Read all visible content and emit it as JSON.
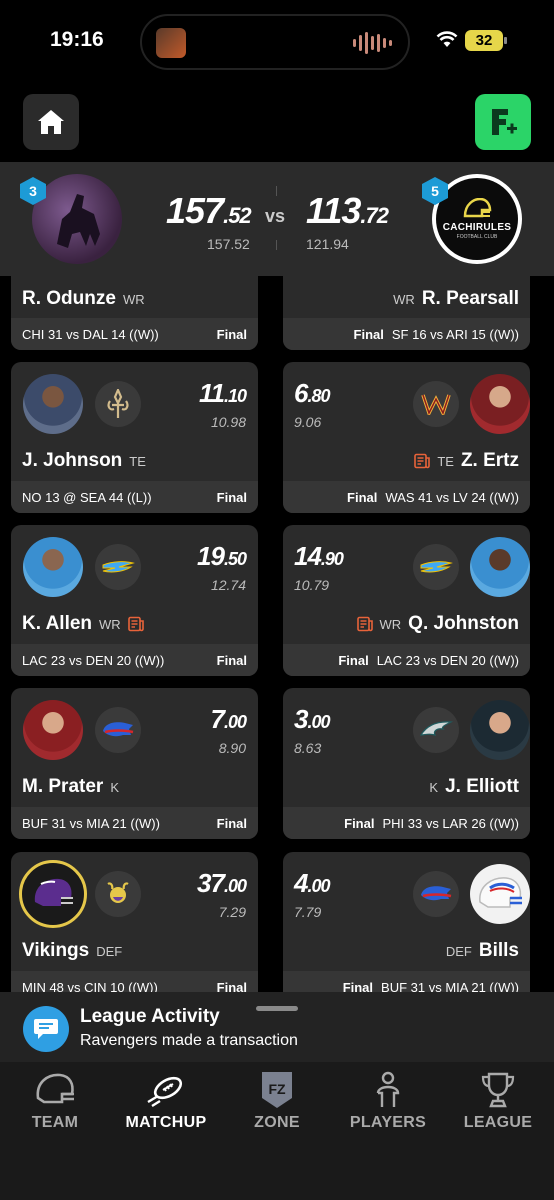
{
  "status": {
    "time": "19:16",
    "battery": "32"
  },
  "matchup": {
    "left": {
      "rank": "3",
      "score_int": "157",
      "score_dec": ".52",
      "projected": "157.52"
    },
    "right": {
      "rank": "5",
      "score_int": "113",
      "score_dec": ".72",
      "projected": "121.94",
      "logo_text": "CACHIRULES",
      "logo_sub": "FOOTBALL CLUB"
    },
    "vs": "vs"
  },
  "rows": [
    {
      "left": {
        "name": "R. Odunze",
        "pos": "WR",
        "game": "CHI 31 vs DAL 14 ((W))",
        "status": "Final"
      },
      "right": {
        "name": "R. Pearsall",
        "pos": "WR",
        "game": "SF 16 vs ARI 15 ((W))",
        "status": "Final"
      }
    },
    {
      "left": {
        "name": "J. Johnson",
        "pos": "TE",
        "pts_int": "11",
        "pts_dec": ".10",
        "proj": "10.98",
        "game": "NO 13 @ SEA 44 ((L))",
        "status": "Final",
        "team": "NO",
        "team_color": "#d3bc8d"
      },
      "right": {
        "name": "Z. Ertz",
        "pos": "TE",
        "pts_int": "6",
        "pts_dec": ".80",
        "proj": "9.06",
        "game": "WAS 41 vs LV 24 ((W))",
        "status": "Final",
        "team": "W",
        "team_color": "#c33a1a"
      }
    },
    {
      "left": {
        "name": "K. Allen",
        "pos": "WR",
        "pts_int": "19",
        "pts_dec": ".50",
        "proj": "12.74",
        "game": "LAC 23 vs DEN 20 ((W))",
        "status": "Final",
        "team": "LAC",
        "team_color": "#3fa9f5"
      },
      "right": {
        "name": "Q. Johnston",
        "pos": "WR",
        "pts_int": "14",
        "pts_dec": ".90",
        "proj": "10.79",
        "game": "LAC 23 vs DEN 20 ((W))",
        "status": "Final",
        "team": "LAC",
        "team_color": "#3fa9f5"
      }
    },
    {
      "left": {
        "name": "M. Prater",
        "pos": "K",
        "pts_int": "7",
        "pts_dec": ".00",
        "proj": "8.90",
        "game": "BUF 31 vs MIA 21 ((W))",
        "status": "Final",
        "team": "BUF",
        "team_color": "#2a5fd6"
      },
      "right": {
        "name": "J. Elliott",
        "pos": "K",
        "pts_int": "3",
        "pts_dec": ".00",
        "proj": "8.63",
        "game": "PHI 33 vs LAR 26 ((W))",
        "status": "Final",
        "team": "PHI",
        "team_color": "#1f5b5e"
      }
    },
    {
      "left": {
        "name": "Vikings",
        "pos": "DEF",
        "pts_int": "37",
        "pts_dec": ".00",
        "proj": "7.29",
        "game": "MIN 48 vs CIN 10 ((W))",
        "status": "Final",
        "team": "MIN",
        "team_color": "#6a3fa0"
      },
      "right": {
        "name": "Bills",
        "pos": "DEF",
        "pts_int": "4",
        "pts_dec": ".00",
        "proj": "7.79",
        "game": "BUF 31 vs MIA 21 ((W))",
        "status": "Final",
        "team": "BUF",
        "team_color": "#2a5fd6"
      }
    }
  ],
  "activity": {
    "title": "League Activity",
    "text": "Ravengers made a transaction"
  },
  "nav": [
    {
      "label": "TEAM",
      "icon": "helmet-icon"
    },
    {
      "label": "MATCHUP",
      "icon": "football-icon",
      "active": true
    },
    {
      "label": "ZONE",
      "icon": "fz-shield-icon"
    },
    {
      "label": "PLAYERS",
      "icon": "player-icon"
    },
    {
      "label": "LEAGUE",
      "icon": "trophy-icon"
    }
  ],
  "colors": {
    "accent_green": "#2bd468",
    "rank_badge": "#1d9bd6",
    "news_orange": "#e8633a"
  }
}
